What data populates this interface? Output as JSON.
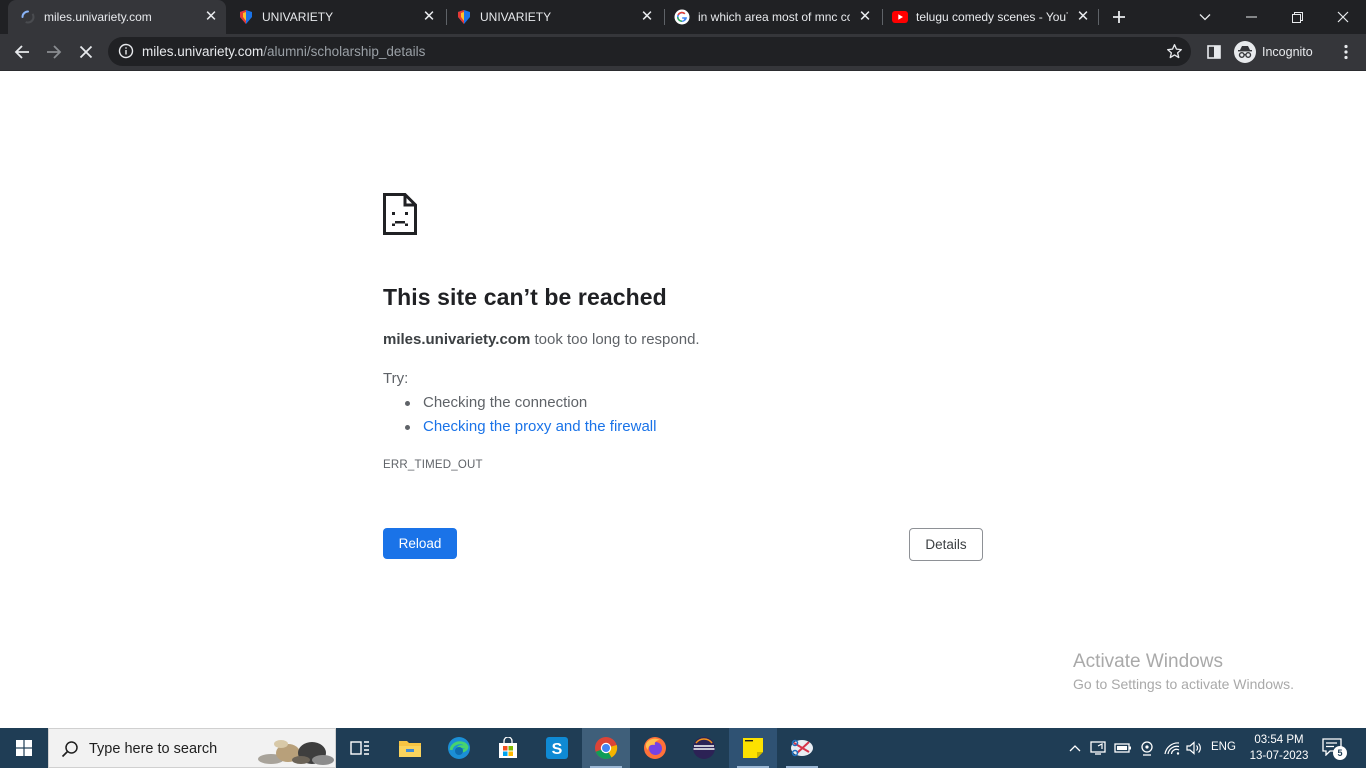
{
  "browser": {
    "tabs": [
      {
        "title": "miles.univariety.com",
        "loading": true
      },
      {
        "title": "UNIVARIETY"
      },
      {
        "title": "UNIVARIETY"
      },
      {
        "title": "in which area most of mnc co"
      },
      {
        "title": "telugu comedy scenes - YouT"
      }
    ],
    "close_glyph": "✕",
    "new_tab_label": "+",
    "omnibox": {
      "host": "miles.univariety.com",
      "path": "/alumni/scholarship_details"
    },
    "profile_label": "Incognito"
  },
  "error_page": {
    "title": "This site can’t be reached",
    "host": "miles.univariety.com",
    "message": " took too long to respond.",
    "try_label": "Try:",
    "suggestions": [
      "Checking the connection",
      "Checking the proxy and the firewall"
    ],
    "error_code": "ERR_TIMED_OUT",
    "reload_label": "Reload",
    "details_label": "Details"
  },
  "watermark": {
    "line1": "Activate Windows",
    "line2": "Go to Settings to activate Windows."
  },
  "taskbar": {
    "search_placeholder": "Type here to search",
    "language": "ENG",
    "time": "03:54 PM",
    "date": "13-07-2023",
    "notification_count": "5"
  },
  "colors": {
    "accent": "#1a73e8",
    "tab_strip": "#202124",
    "toolbar": "#35363a",
    "taskbar": "#1f3d55"
  }
}
